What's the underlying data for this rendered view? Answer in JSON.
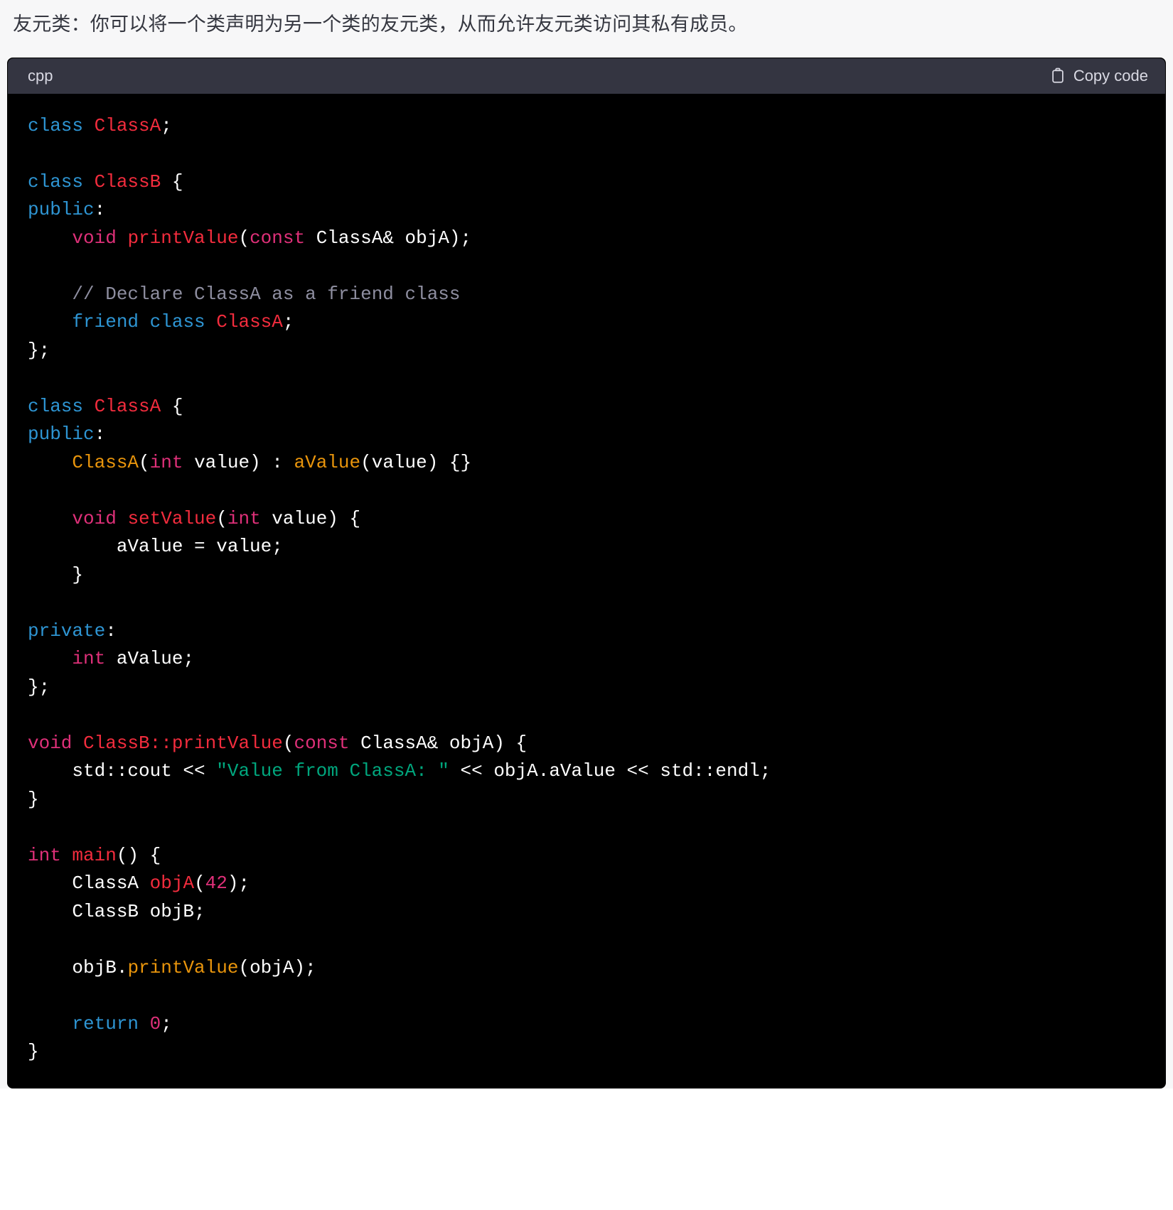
{
  "intro": {
    "text": "友元类：你可以将一个类声明为另一个类的友元类，从而允许友元类访问其私有成员。"
  },
  "code_block": {
    "language": "cpp",
    "copy_label": "Copy code",
    "copy_icon": "clipboard-icon",
    "colors": {
      "background": "#000000",
      "header_background": "#343541",
      "keyword": "#2e95d3",
      "class_name": "#f22c3d",
      "type": "#df3079",
      "function_orange": "#e9950c",
      "number": "#df3079",
      "string": "#00a67d",
      "comment": "#8e8ea0",
      "plain": "#ffffff",
      "page_background": "#f7f7f8",
      "intro_text": "#353740"
    },
    "lines": [
      [
        {
          "t": "class ",
          "c": "key"
        },
        {
          "t": "ClassA",
          "c": "cls"
        },
        {
          "t": ";",
          "c": "pln"
        }
      ],
      [],
      [
        {
          "t": "class ",
          "c": "key"
        },
        {
          "t": "ClassB ",
          "c": "cls"
        },
        {
          "t": "{",
          "c": "pln"
        }
      ],
      [
        {
          "t": "public",
          "c": "key"
        },
        {
          "t": ":",
          "c": "pln"
        }
      ],
      [
        {
          "t": "    ",
          "c": "pln"
        },
        {
          "t": "void ",
          "c": "type"
        },
        {
          "t": "printValue",
          "c": "fn"
        },
        {
          "t": "(",
          "c": "pln"
        },
        {
          "t": "const ",
          "c": "type"
        },
        {
          "t": "ClassA& objA);",
          "c": "pln"
        }
      ],
      [],
      [
        {
          "t": "    ",
          "c": "pln"
        },
        {
          "t": "// Declare ClassA as a friend class",
          "c": "com"
        }
      ],
      [
        {
          "t": "    ",
          "c": "pln"
        },
        {
          "t": "friend class ",
          "c": "key"
        },
        {
          "t": "ClassA",
          "c": "cls"
        },
        {
          "t": ";",
          "c": "pln"
        }
      ],
      [
        {
          "t": "};",
          "c": "pln"
        }
      ],
      [],
      [
        {
          "t": "class ",
          "c": "key"
        },
        {
          "t": "ClassA ",
          "c": "cls"
        },
        {
          "t": "{",
          "c": "pln"
        }
      ],
      [
        {
          "t": "public",
          "c": "key"
        },
        {
          "t": ":",
          "c": "pln"
        }
      ],
      [
        {
          "t": "    ",
          "c": "pln"
        },
        {
          "t": "ClassA",
          "c": "fnorg"
        },
        {
          "t": "(",
          "c": "pln"
        },
        {
          "t": "int",
          "c": "type"
        },
        {
          "t": " value) : ",
          "c": "pln"
        },
        {
          "t": "aValue",
          "c": "fnorg"
        },
        {
          "t": "(value) {}",
          "c": "pln"
        }
      ],
      [],
      [
        {
          "t": "    ",
          "c": "pln"
        },
        {
          "t": "void ",
          "c": "type"
        },
        {
          "t": "setValue",
          "c": "fn"
        },
        {
          "t": "(",
          "c": "pln"
        },
        {
          "t": "int",
          "c": "type"
        },
        {
          "t": " value) {",
          "c": "pln"
        }
      ],
      [
        {
          "t": "        aValue = value;",
          "c": "pln"
        }
      ],
      [
        {
          "t": "    }",
          "c": "pln"
        }
      ],
      [],
      [
        {
          "t": "private",
          "c": "key"
        },
        {
          "t": ":",
          "c": "pln"
        }
      ],
      [
        {
          "t": "    ",
          "c": "pln"
        },
        {
          "t": "int",
          "c": "type"
        },
        {
          "t": " aValue;",
          "c": "pln"
        }
      ],
      [
        {
          "t": "};",
          "c": "pln"
        }
      ],
      [],
      [
        {
          "t": "void ",
          "c": "type"
        },
        {
          "t": "ClassB::printValue",
          "c": "fn"
        },
        {
          "t": "(",
          "c": "pln"
        },
        {
          "t": "const ",
          "c": "type"
        },
        {
          "t": "ClassA& objA) {",
          "c": "pln"
        }
      ],
      [
        {
          "t": "    std::cout << ",
          "c": "pln"
        },
        {
          "t": "\"Value from ClassA: \"",
          "c": "str"
        },
        {
          "t": " << objA.aValue << std::endl;",
          "c": "pln"
        }
      ],
      [
        {
          "t": "}",
          "c": "pln"
        }
      ],
      [],
      [
        {
          "t": "int ",
          "c": "type"
        },
        {
          "t": "main",
          "c": "fn"
        },
        {
          "t": "() {",
          "c": "pln"
        }
      ],
      [
        {
          "t": "    ClassA ",
          "c": "pln"
        },
        {
          "t": "objA",
          "c": "fn"
        },
        {
          "t": "(",
          "c": "pln"
        },
        {
          "t": "42",
          "c": "num"
        },
        {
          "t": ");",
          "c": "pln"
        }
      ],
      [
        {
          "t": "    ClassB objB;",
          "c": "pln"
        }
      ],
      [],
      [
        {
          "t": "    objB.",
          "c": "pln"
        },
        {
          "t": "printValue",
          "c": "fnorg"
        },
        {
          "t": "(objA);",
          "c": "pln"
        }
      ],
      [],
      [
        {
          "t": "    ",
          "c": "pln"
        },
        {
          "t": "return ",
          "c": "key"
        },
        {
          "t": "0",
          "c": "num"
        },
        {
          "t": ";",
          "c": "pln"
        }
      ],
      [
        {
          "t": "}",
          "c": "pln"
        }
      ]
    ]
  }
}
